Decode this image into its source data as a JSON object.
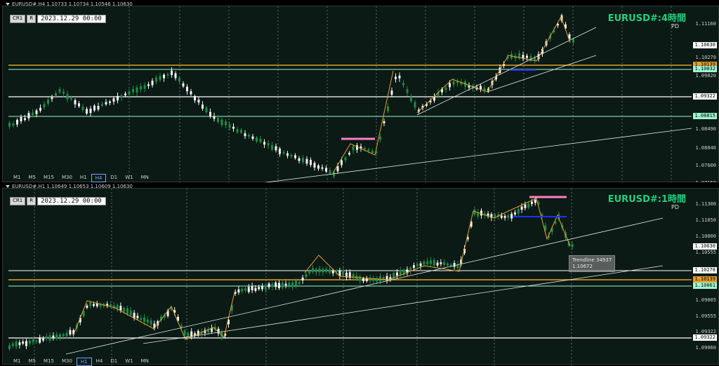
{
  "window1": {
    "header": "EURUSD#,H4  1.10733 1.10734 1.10546 1.10630",
    "date": "2023.12.29 00:00",
    "symbol_label": "EURUSD#:4時間",
    "pd": "PD",
    "btn_cr1": "CR1",
    "btn_r": "R",
    "timeframes": [
      "M1",
      "M5",
      "M15",
      "M30",
      "H1",
      "H4",
      "D1",
      "W1",
      "MN"
    ],
    "active_tf": "H4",
    "ticks": [
      "1.11160",
      "1.10630",
      "1.10270",
      "1.09820",
      "1.09322",
      "1.08815",
      "1.08490",
      "1.08040",
      "1.07600",
      "1.07150"
    ],
    "price_tags": [
      {
        "label": "1.10630",
        "color": "#ffffff",
        "bg": "#ffffff",
        "fg": "#000000"
      },
      {
        "label": "1.10139",
        "color": "#e0a030",
        "bg": "#e0a030",
        "fg": "#000000"
      },
      {
        "label": "1.10032",
        "color": "#9ff7d2",
        "bg": "#9ff7d2",
        "fg": "#000000"
      },
      {
        "label": "1.09322",
        "color": "#ffffff",
        "bg": "#ffffff",
        "fg": "#000000"
      },
      {
        "label": "1.08815",
        "color": "#9ff7d2",
        "bg": "#9ff7d2",
        "fg": "#000000"
      }
    ]
  },
  "window2": {
    "header": "EURUSD#,H1  1.10649 1.10653 1.10609 1.10630",
    "date": "2023.12.29 00:00",
    "symbol_label": "EURUSD#:1時間",
    "pd": "PD",
    "btn_cr1": "CR1",
    "btn_r": "R",
    "timeframes": [
      "M1",
      "M5",
      "M15",
      "M30",
      "H1",
      "H4",
      "D1",
      "W1",
      "MN"
    ],
    "active_tf": "H1",
    "ticks": [
      "1.11300",
      "1.11050",
      "1.10800",
      "1.10555",
      "1.10278",
      "1.10061",
      "1.09805",
      "1.09555",
      "1.09322",
      "1.09060"
    ],
    "price_tags": [
      {
        "label": "1.10630",
        "color": "#ffffff",
        "bg": "#ffffff",
        "fg": "#000000"
      },
      {
        "label": "1.10278",
        "color": "#ffffff",
        "bg": "#ffffff",
        "fg": "#000000"
      },
      {
        "label": "1.10139",
        "color": "#e0a030",
        "bg": "#e0a030",
        "fg": "#000000"
      },
      {
        "label": "1.10061",
        "color": "#9ff7d2",
        "bg": "#9ff7d2",
        "fg": "#000000"
      },
      {
        "label": "1.09322",
        "color": "#ffffff",
        "bg": "#ffffff",
        "fg": "#000000"
      }
    ],
    "tooltip_line1": "Trendline 34937",
    "tooltip_line2": "1.10672"
  },
  "colors": {
    "bull": "#1e8a4a",
    "bear": "#f2f2f2",
    "bg": "#0b1a14",
    "accent": "#22d07f",
    "orange": "#e0a030",
    "mint": "#9ff7d2",
    "pink": "#ff7fc8",
    "blue": "#2030ff"
  }
}
